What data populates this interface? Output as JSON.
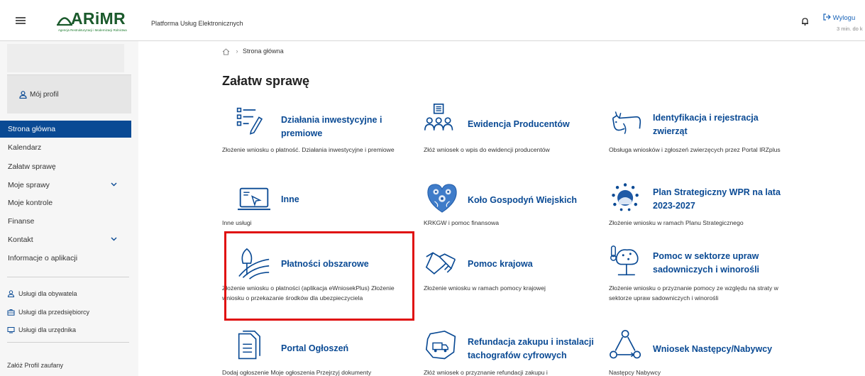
{
  "header": {
    "logo_text": "ARiMR",
    "logo_subtitle": "Agencja Restrukturyzacji i Modernizacji Rolnictwa",
    "platform_title": "Platforma Usług Elektronicznych",
    "logout_label": "Wylogu",
    "session_text": "3 min. do k"
  },
  "sidebar": {
    "profile_label": "Mój profil",
    "nav": [
      {
        "label": "Strona główna",
        "active": true
      },
      {
        "label": "Kalendarz"
      },
      {
        "label": "Załatw sprawę"
      },
      {
        "label": "Moje sprawy",
        "expandable": true
      },
      {
        "label": "Moje kontrole"
      },
      {
        "label": "Finanse"
      },
      {
        "label": "Kontakt",
        "expandable": true
      },
      {
        "label": "Informacje o aplikacji"
      }
    ],
    "services": [
      {
        "label": "Usługi dla obywatela",
        "icon": "person-icon"
      },
      {
        "label": "Usługi dla przedsiębiorcy",
        "icon": "briefcase-icon"
      },
      {
        "label": "Usługi dla urzędnika",
        "icon": "monitor-icon"
      }
    ],
    "trusted_profile": "Załóż Profil zaufany"
  },
  "breadcrumb": {
    "home_icon": "home-icon",
    "current": "Strona główna"
  },
  "main": {
    "title": "Załatw sprawę",
    "tiles": [
      {
        "title": "Działania inwestycyjne i premiowe",
        "desc": "Złożenie wniosku o płatność. Działania inwestycyjne i premiowe",
        "icon": "document-pen-icon"
      },
      {
        "title": "Ewidencja Producentów",
        "desc": "Złóż wniosek o wpis do ewidencji producentów",
        "icon": "people-list-icon"
      },
      {
        "title": "Identyfikacja i rejestracja zwierząt",
        "desc": "Obsługa wniosków i zgłoszeń zwierzęcych przez Portal IRZplus",
        "icon": "cow-icon"
      },
      {
        "title": "Inne",
        "desc": "Inne usługi",
        "icon": "laptop-cursor-icon"
      },
      {
        "title": "Koło Gospodyń Wiejskich",
        "desc": "KRKGW i pomoc finansowa",
        "icon": "folk-heart-icon"
      },
      {
        "title": "Plan Strategiczny WPR na lata 2023-2027",
        "desc": "Złożenie wniosku w ramach Planu Strategicznego",
        "icon": "eu-stars-icon"
      },
      {
        "title": "Płatności obszarowe",
        "desc": "Złożenie wniosku o płatności (aplikacja eWniosekPlus) Złożenie wniosku o przekazanie środków dla ubezpieczyciela",
        "icon": "field-tree-icon"
      },
      {
        "title": "Pomoc krajowa",
        "desc": "Złożenie wniosku w ramach pomocy krajowej",
        "icon": "handshake-icon"
      },
      {
        "title": "Pomoc w sektorze upraw sadowniczych i winorośli",
        "desc": "Złożenie wniosku o przyznanie pomocy ze względu na straty w sektorze upraw sadowniczych i winorośli",
        "icon": "fruit-tree-icon"
      },
      {
        "title": "Portal Ogłoszeń",
        "desc": "Dodaj ogłoszenie Moje ogłoszenia Przejrzyj dokumenty",
        "icon": "documents-icon"
      },
      {
        "title": "Refundacja zakupu i instalacji tachografów cyfrowych",
        "desc": "Złóż wniosek o przyznanie refundacji zakupu i",
        "icon": "truck-map-icon"
      },
      {
        "title": "Wniosek Następcy/Nabywcy",
        "desc": "Następcy Nabywcy",
        "icon": "cycle-icon"
      }
    ]
  },
  "colors": {
    "accent": "#0a4a94",
    "logo_green": "#1b5a2c",
    "highlight": "#e01010"
  }
}
